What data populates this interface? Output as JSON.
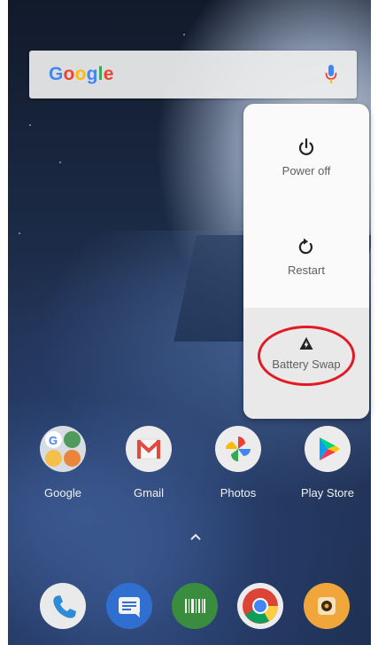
{
  "search": {
    "logo": "Google",
    "logo_letters": [
      "G",
      "o",
      "o",
      "g",
      "l",
      "e"
    ],
    "mic_icon": "microphone-icon"
  },
  "power_menu": {
    "items": [
      {
        "label": "Power off",
        "icon": "power-icon"
      },
      {
        "label": "Restart",
        "icon": "restart-icon"
      },
      {
        "label": "Battery Swap",
        "icon": "battery-swap-icon"
      }
    ],
    "highlight_color": "#e01b24"
  },
  "apps": [
    {
      "label": "Google",
      "icon": "google-folder-icon"
    },
    {
      "label": "Gmail",
      "icon": "gmail-icon"
    },
    {
      "label": "Photos",
      "icon": "photos-icon"
    },
    {
      "label": "Play Store",
      "icon": "play-store-icon"
    }
  ],
  "dock": [
    {
      "icon": "phone-icon"
    },
    {
      "icon": "messages-icon"
    },
    {
      "icon": "barcode-scanner-icon"
    },
    {
      "icon": "chrome-icon"
    },
    {
      "icon": "camera-icon"
    }
  ]
}
